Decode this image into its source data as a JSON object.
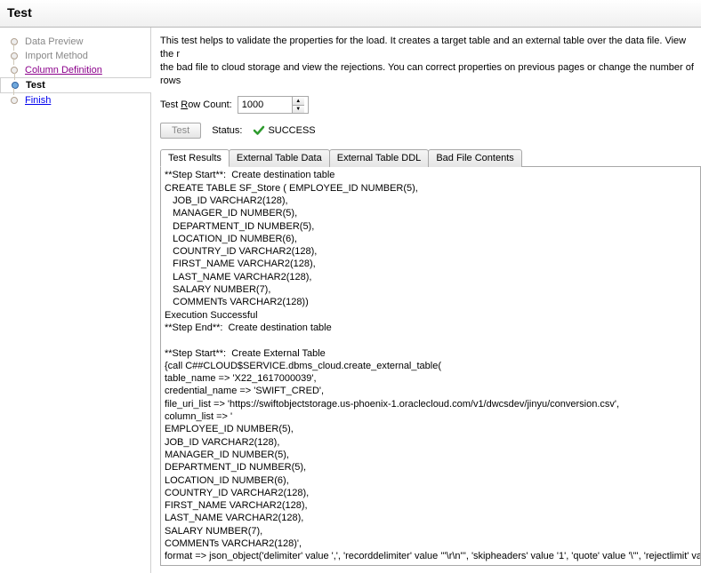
{
  "header": {
    "title": "Test"
  },
  "sidebar": {
    "items": [
      {
        "label": "Data Preview",
        "state": "disabled"
      },
      {
        "label": "Import Method",
        "state": "disabled"
      },
      {
        "label": "Column Definition",
        "state": "visited"
      },
      {
        "label": "Test",
        "state": "active"
      },
      {
        "label": "Finish",
        "state": "link"
      }
    ]
  },
  "content": {
    "intro": "This test helps to validate the properties for the load.  It creates a target table and an external table over the data file.  View the r\nthe bad file to cloud storage and view the rejections.  You can correct properties on previous pages or change the number of rows",
    "rowCount": {
      "label_pre": "Test ",
      "label_mn": "R",
      "label_post": "ow Count:",
      "value": "1000"
    },
    "testButton": "Test",
    "statusLabel": "Status:",
    "statusValue": "SUCCESS",
    "tabs": [
      {
        "label": "Test Results",
        "active": true
      },
      {
        "label": "External Table Data",
        "active": false
      },
      {
        "label": "External Table DDL",
        "active": false
      },
      {
        "label": "Bad File Contents",
        "active": false
      }
    ],
    "results": "**Step Start**:  Create destination table\nCREATE TABLE SF_Store ( EMPLOYEE_ID NUMBER(5),\n   JOB_ID VARCHAR2(128),\n   MANAGER_ID NUMBER(5),\n   DEPARTMENT_ID NUMBER(5),\n   LOCATION_ID NUMBER(6),\n   COUNTRY_ID VARCHAR2(128),\n   FIRST_NAME VARCHAR2(128),\n   LAST_NAME VARCHAR2(128),\n   SALARY NUMBER(7),\n   COMMENTs VARCHAR2(128))\nExecution Successful\n**Step End**:  Create destination table\n\n**Step Start**:  Create External Table\n{call C##CLOUD$SERVICE.dbms_cloud.create_external_table(\ntable_name => 'X22_1617000039',\ncredential_name => 'SWIFT_CRED',\nfile_uri_list => 'https://swiftobjectstorage.us-phoenix-1.oraclecloud.com/v1/dwcsdev/jinyu/conversion.csv',\ncolumn_list => '\nEMPLOYEE_ID NUMBER(5),\nJOB_ID VARCHAR2(128),\nMANAGER_ID NUMBER(5),\nDEPARTMENT_ID NUMBER(5),\nLOCATION_ID NUMBER(6),\nCOUNTRY_ID VARCHAR2(128),\nFIRST_NAME VARCHAR2(128),\nLAST_NAME VARCHAR2(128),\nSALARY NUMBER(7),\nCOMMENTs VARCHAR2(128)',\nformat => json_object('delimiter' value ',', 'recorddelimiter' value '''\\r\\n''', 'skipheaders' value '1', 'quote' value '\\\"', 'rejectlimit' valu"
  }
}
